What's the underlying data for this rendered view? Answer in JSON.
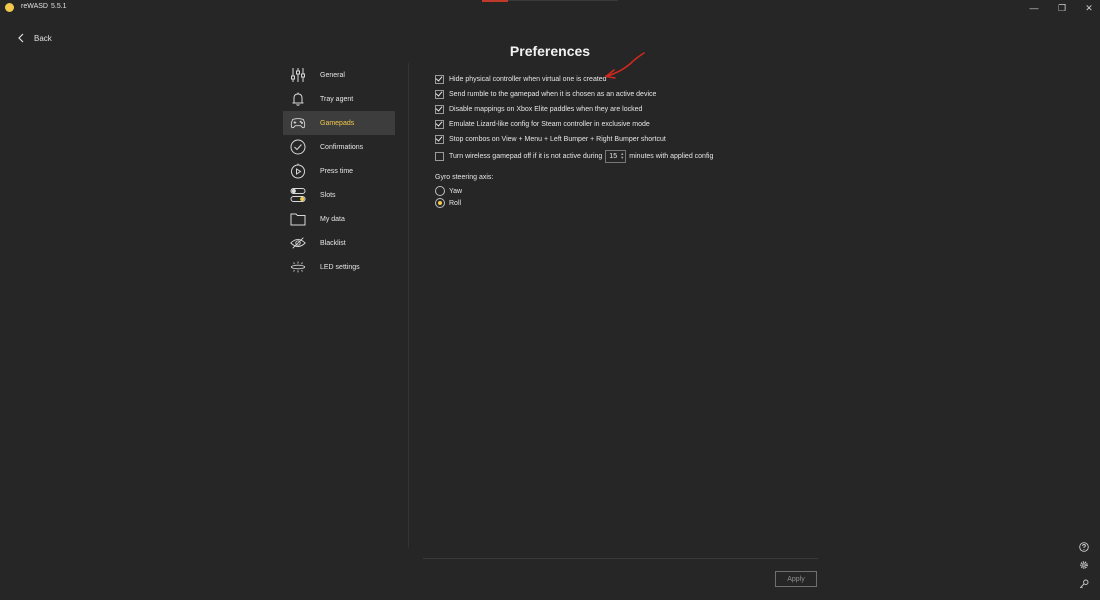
{
  "window": {
    "app_name": "reWASD",
    "version": "5.5.1",
    "minimize": "—",
    "restore": "❐",
    "close": "✕"
  },
  "nav": {
    "back_label": "Back"
  },
  "page": {
    "title": "Preferences"
  },
  "sidebar": {
    "items": [
      {
        "label": "General",
        "icon": "sliders-icon"
      },
      {
        "label": "Tray agent",
        "icon": "bell-icon"
      },
      {
        "label": "Gamepads",
        "icon": "gamepad-icon",
        "active": true
      },
      {
        "label": "Confirmations",
        "icon": "check-circle-icon"
      },
      {
        "label": "Press time",
        "icon": "timer-icon"
      },
      {
        "label": "Slots",
        "icon": "toggles-icon"
      },
      {
        "label": "My data",
        "icon": "folder-icon"
      },
      {
        "label": "Blacklist",
        "icon": "eye-off-icon"
      },
      {
        "label": "LED settings",
        "icon": "led-icon"
      }
    ]
  },
  "gamepads": {
    "options": [
      {
        "label": "Hide physical controller when virtual one is created",
        "checked": true
      },
      {
        "label": "Send rumble to the gamepad when it is chosen as an active device",
        "checked": true
      },
      {
        "label": "Disable mappings on Xbox Elite paddles when they are locked",
        "checked": true
      },
      {
        "label": "Emulate Lizard-like config for Steam controller in exclusive mode",
        "checked": true
      },
      {
        "label": "Stop combos on View + Menu + Left Bumper + Right Bumper shortcut",
        "checked": true
      }
    ],
    "wireless": {
      "label_before": "Turn wireless gamepad off if it is not active during",
      "minutes_value": "15",
      "label_after": "minutes with applied config",
      "checked": false
    },
    "gyro": {
      "label": "Gyro steering axis:",
      "options": [
        {
          "label": "Yaw",
          "selected": false
        },
        {
          "label": "Roll",
          "selected": true
        }
      ]
    }
  },
  "footer": {
    "apply_label": "Apply"
  },
  "colors": {
    "accent": "#f2c94c",
    "background": "#262626",
    "annotation": "#d0281e"
  }
}
